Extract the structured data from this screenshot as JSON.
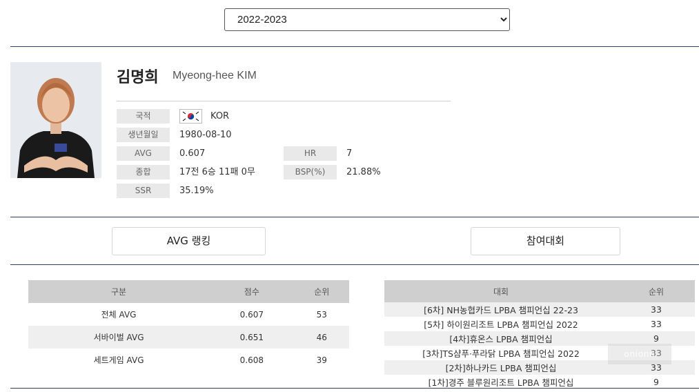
{
  "season": {
    "selected": "2022-2023"
  },
  "player": {
    "name_ko": "김명희",
    "name_en": "Myeong-hee KIM",
    "nationality_label": "국적",
    "nationality_value": "KOR",
    "birth_label": "생년월일",
    "birth_value": "1980-08-10",
    "avg_label": "AVG",
    "avg_value": "0.607",
    "hr_label": "HR",
    "hr_value": "7",
    "total_label": "종합",
    "total_value": "17전 6승 11패 0무",
    "bsp_label": "BSP(%)",
    "bsp_value": "21.88%",
    "ssr_label": "SSR",
    "ssr_value": "35.19%"
  },
  "tabs": {
    "avg_ranking": "AVG 랭킹",
    "tournaments": "참여대회"
  },
  "avg_table": {
    "headers": [
      "구분",
      "점수",
      "순위"
    ],
    "rows": [
      [
        "전체 AVG",
        "0.607",
        "53"
      ],
      [
        "서바이벌 AVG",
        "0.651",
        "46"
      ],
      [
        "세트게임 AVG",
        "0.608",
        "39"
      ]
    ]
  },
  "tournament_table": {
    "headers": [
      "대회",
      "순위"
    ],
    "rows": [
      [
        "[6차] NH농협카드 LPBA 챔피언십 22-23",
        "33"
      ],
      [
        "[5차] 하이원리조트 LPBA 챔피언십 2022",
        "33"
      ],
      [
        "[4차]휴온스 LPBA 챔피언십",
        "9"
      ],
      [
        "[3차]TS샴푸·푸라닭 LPBA 챔피언십 2022",
        "33"
      ],
      [
        "[2차]하나카드 LPBA 챔피언십",
        "33"
      ],
      [
        "[1차]경주 블루원리조트 LPBA 챔피언십",
        "9"
      ]
    ]
  },
  "watermark": "onionu",
  "colors": {
    "rule": "#2f3f5f",
    "label_bg": "#e9e9e9",
    "header_bg": "#cfcfcf",
    "stripe": "#efefef"
  }
}
